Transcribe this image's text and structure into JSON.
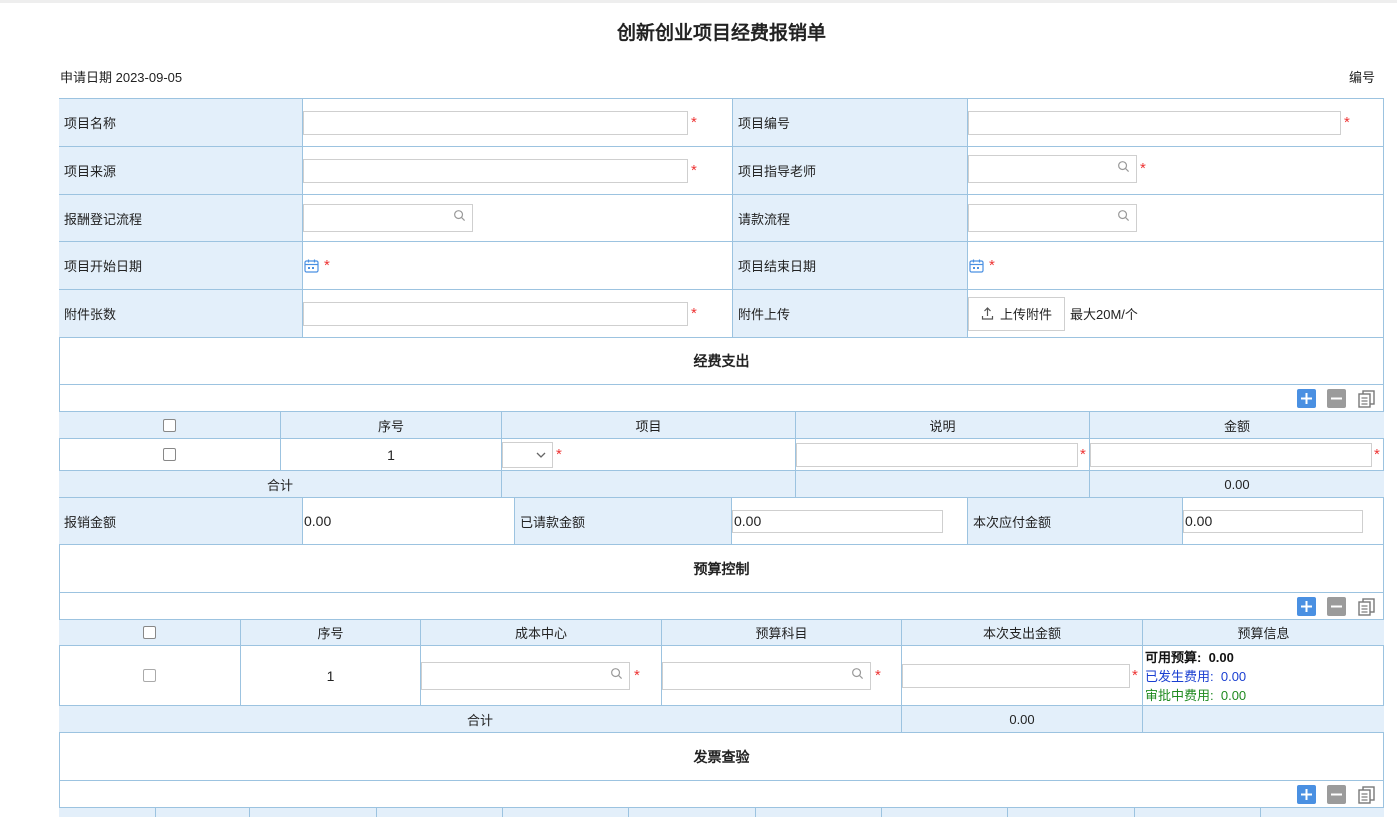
{
  "title": "创新创业项目经费报销单",
  "apply_date": "申请日期 2023-09-05",
  "code_label": "编号",
  "form": {
    "project_name": "项目名称",
    "project_code": "项目编号",
    "project_source": "项目来源",
    "project_mentor": "项目指导老师",
    "reimburse_flow": "报酬登记流程",
    "request_flow": "请款流程",
    "start_date": "项目开始日期",
    "end_date": "项目结束日期",
    "attachment_count": "附件张数",
    "attachment_upload": "附件上传",
    "upload_button": "上传附件",
    "upload_limit": "最大20M/个",
    "required_mark": "*"
  },
  "expense": {
    "section_title": "经费支出",
    "headers": [
      "序号",
      "项目",
      "说明",
      "金额"
    ],
    "row_index": "1",
    "total_label": "合计",
    "total_value": "0.00",
    "reimburse_amount_label": "报销金额",
    "reimburse_amount_value": "0.00",
    "requested_amount_label": "已请款金额",
    "requested_amount_value": "0.00",
    "payable_amount_label": "本次应付金额",
    "payable_amount_value": "0.00"
  },
  "budget": {
    "section_title": "预算控制",
    "headers": [
      "序号",
      "成本中心",
      "预算科目",
      "本次支出金额",
      "预算信息"
    ],
    "row_index": "1",
    "available_label": "可用预算:",
    "available_value": "0.00",
    "incurred_label": "已发生费用:",
    "incurred_value": "0.00",
    "pending_label": "审批中费用:",
    "pending_value": "0.00",
    "total_label": "合计",
    "total_value": "0.00"
  },
  "invoice": {
    "section_title": "发票查验"
  },
  "colors": {
    "border": "#9cc3e0",
    "label_bg": "#e3effa",
    "required": "#e33333",
    "add_button": "#4a90e2",
    "incurred_text": "#1a3fd1",
    "pending_text": "#1f8a1f"
  }
}
